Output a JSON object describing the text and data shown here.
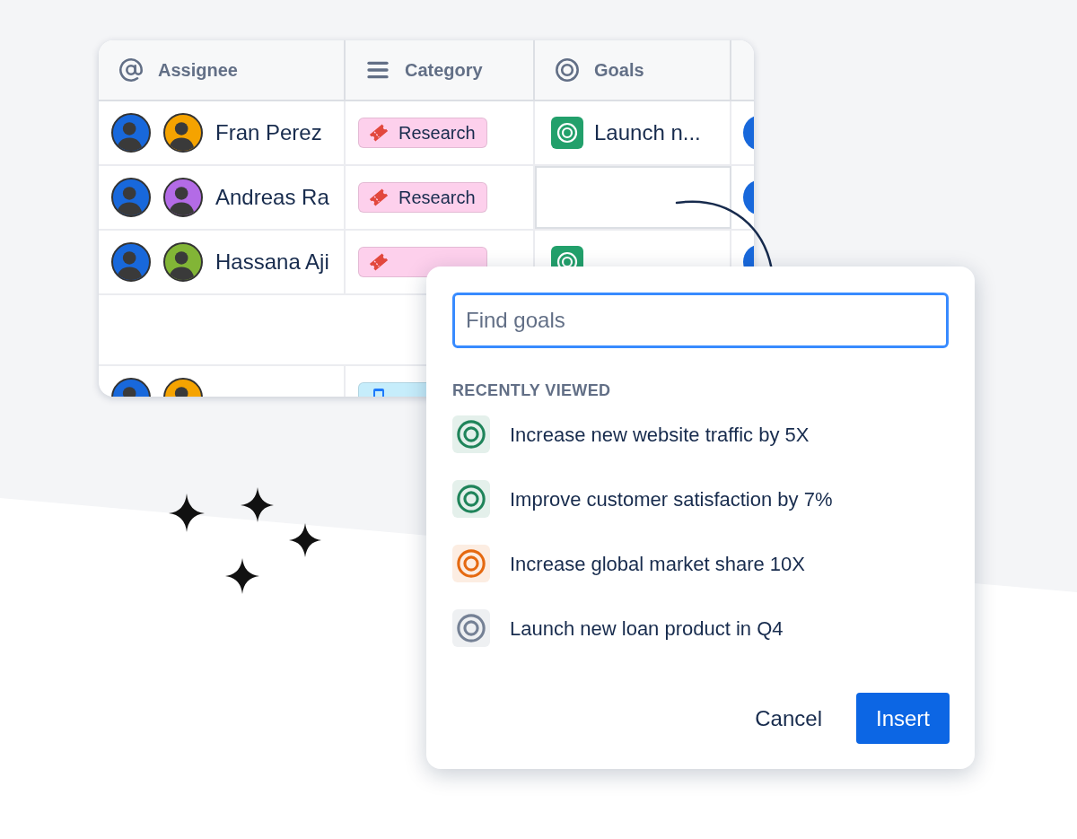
{
  "table": {
    "columns": [
      {
        "label": "Assignee"
      },
      {
        "label": "Category"
      },
      {
        "label": "Goals"
      }
    ],
    "rows": [
      {
        "kind": "entry",
        "avatars": [
          {
            "color": "#1868db"
          },
          {
            "color": "#f5a300"
          }
        ],
        "name": "Fran Perez",
        "category": {
          "label": "Research",
          "kind": "ticket",
          "color": "#fdd0ec"
        },
        "goal": {
          "label": "Launch n...",
          "selected": false
        },
        "column_4": {
          "color": "#1868db"
        }
      },
      {
        "kind": "entry",
        "avatars": [
          {
            "color": "#1868db"
          },
          {
            "color": "#b36be6"
          }
        ],
        "name": "Andreas Ra",
        "category": {
          "label": "Research",
          "kind": "ticket",
          "color": "#fdd0ec"
        },
        "goal": {
          "selected": true
        },
        "column_4": {
          "color": "#1868db"
        }
      },
      {
        "kind": "entry",
        "avatars": [
          {
            "color": "#1868db"
          },
          {
            "color": "#82b536"
          }
        ],
        "name": "Hassana Aji",
        "category": {
          "kind": "ticket",
          "color": "#fdd0ec"
        },
        "goal": {
          "selected": false
        },
        "column_4": {
          "color": "#1868db"
        }
      },
      {
        "kind": "empty"
      },
      {
        "kind": "entry",
        "avatars": [
          {
            "color": "#1868db"
          },
          {
            "color": "#f5a300"
          }
        ],
        "category": {
          "kind": "device",
          "color": "#c6edfb"
        }
      }
    ]
  },
  "popup": {
    "search": {
      "placeholder": "Find goals"
    },
    "section_title": "RECENTLY VIEWED",
    "goals": [
      {
        "label": "Increase new website traffic by 5X",
        "color": "#1f845a"
      },
      {
        "label": "Improve customer satisfaction by 7%",
        "color": "#1f845a"
      },
      {
        "label": "Increase global market share 10X",
        "color": "#e56910"
      },
      {
        "label": "Launch new loan product in Q4",
        "color": "#758195"
      }
    ],
    "buttons": [
      {
        "label": "Cancel",
        "kind": "subtle"
      },
      {
        "label": "Insert",
        "kind": "primary"
      }
    ]
  }
}
